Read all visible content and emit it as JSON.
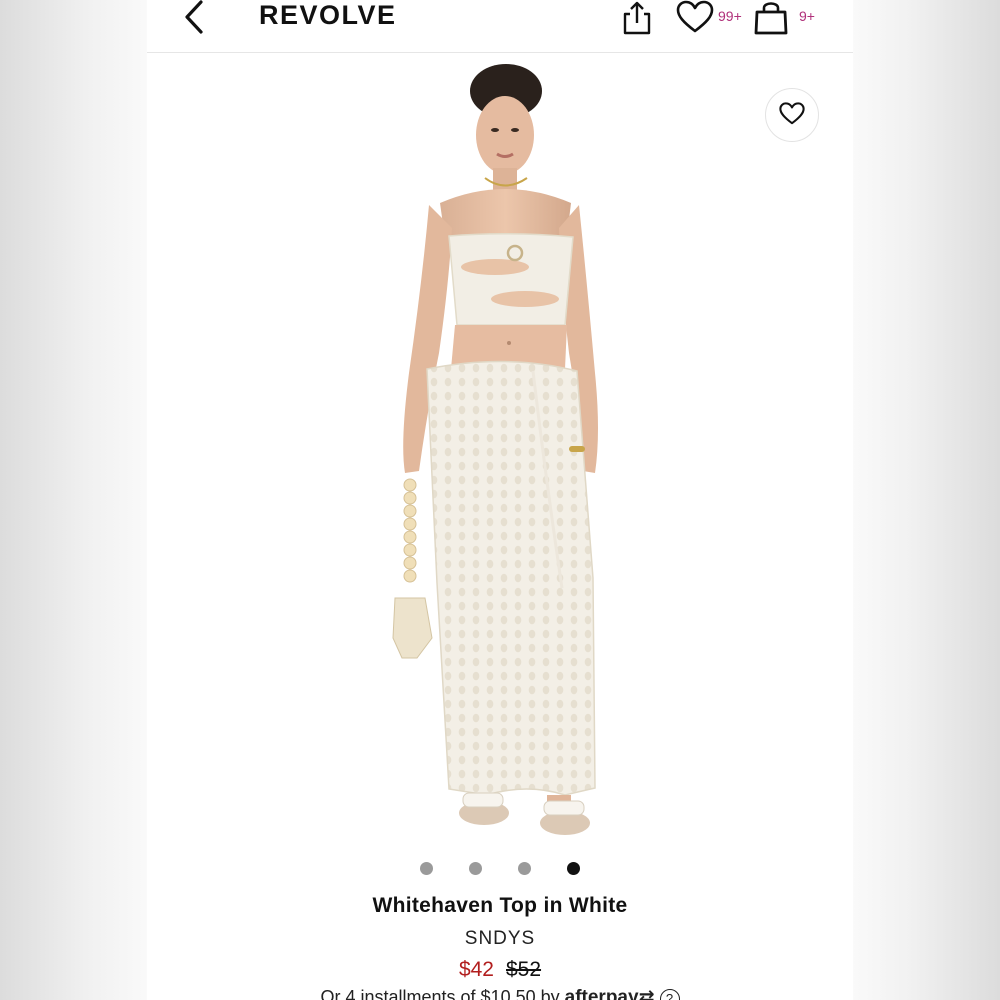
{
  "header": {
    "logo": "REVOLVE",
    "wishlist_count": "99+",
    "bag_count": "9+"
  },
  "gallery": {
    "image_count": 4,
    "active_index": 3
  },
  "product": {
    "title": "Whitehaven Top in White",
    "brand": "SNDYS",
    "sale_price": "$42",
    "original_price": "$52",
    "installments_text": "Or 4 installments of $10.50 by",
    "afterpay_label": "afterpay",
    "afterpay_arrows": "⇄",
    "info_label": "?"
  },
  "colors": {
    "sale_price": "#b21e1e",
    "badge": "#b0307a"
  }
}
